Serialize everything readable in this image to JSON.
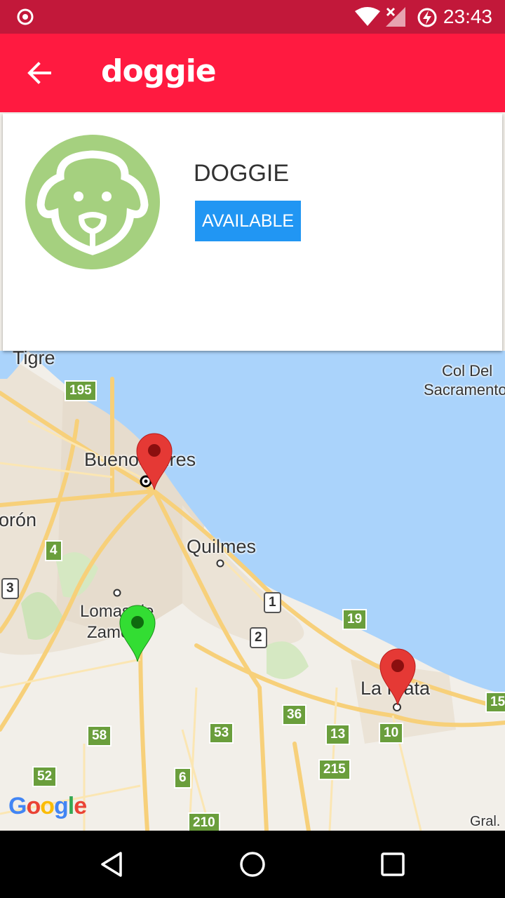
{
  "status_bar": {
    "time": "23:43",
    "icons": [
      "notification-icon",
      "wifi-icon",
      "signal-icon",
      "battery-charging-icon"
    ]
  },
  "app_bar": {
    "title": "doggie",
    "back_icon": "arrow-left-icon",
    "color": "#ff1a40"
  },
  "card": {
    "name": "DOGGIE",
    "status": "AVAILABLE",
    "status_color": "#2196f3",
    "avatar_color": "#a5d07f"
  },
  "map": {
    "labels": {
      "tigre": "Tigre",
      "col_del": "Col Del",
      "sacramento": "Sacramento",
      "buenos_aires": "Buenos Aires",
      "moron": "orón",
      "quilmes": "Quilmes",
      "lomas": "Lomas de",
      "zamora": "Zamora",
      "la_plata": "La Plata",
      "gral": "Gral."
    },
    "routes": {
      "r195": "195",
      "r4": "4",
      "r3": "3",
      "r1": "1",
      "r2": "2",
      "r19": "19",
      "r58": "58",
      "r53": "53",
      "r36": "36",
      "r13": "13",
      "r10": "10",
      "r15": "15",
      "r52": "52",
      "r6": "6",
      "r215": "215",
      "r210": "210"
    },
    "google": "Google",
    "marker_colors": {
      "red": "#e53935",
      "green": "#33dd33"
    }
  },
  "nav_bar": {
    "icons": [
      "back-triangle-icon",
      "home-circle-icon",
      "recents-square-icon"
    ]
  }
}
